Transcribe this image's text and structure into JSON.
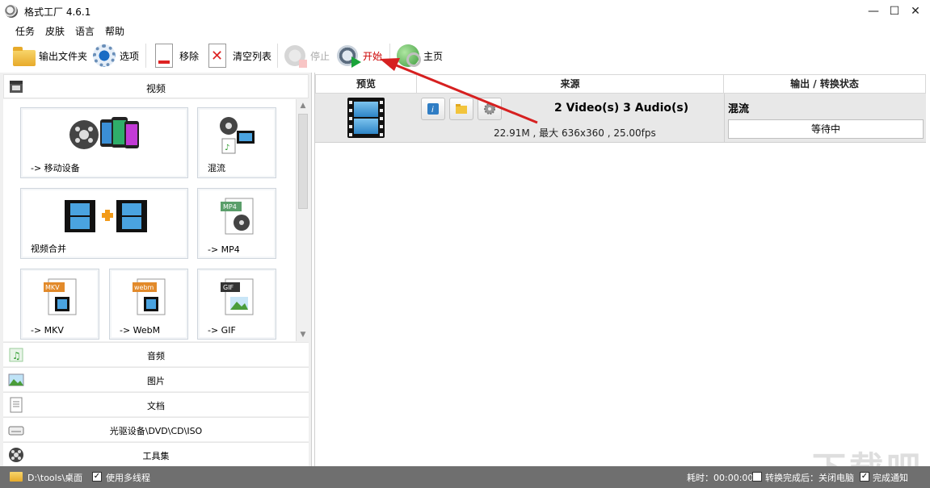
{
  "window": {
    "title": "格式工厂 4.6.1",
    "minimize": "—",
    "maximize": "☐",
    "close": "✕"
  },
  "menu": [
    "任务",
    "皮肤",
    "语言",
    "帮助"
  ],
  "toolbar": {
    "output_folder": "输出文件夹",
    "options": "选项",
    "remove": "移除",
    "clear_list": "清空列表",
    "stop": "停止",
    "start": "开始",
    "home": "主页"
  },
  "left": {
    "video_header": "视频",
    "tiles": [
      {
        "label": "-> 移动设备"
      },
      {
        "label": "混流"
      },
      {
        "label": "视频合并"
      },
      {
        "label": "-> MP4"
      },
      {
        "label": "-> MKV"
      },
      {
        "label": "-> WebM"
      },
      {
        "label": "-> GIF"
      }
    ],
    "tile_badges": {
      "mp4": "MP4",
      "mkv": "MKV",
      "webm": "webm",
      "gif": "GIF"
    },
    "categories": [
      "音频",
      "图片",
      "文档",
      "光驱设备\\DVD\\CD\\ISO",
      "工具集"
    ]
  },
  "right": {
    "columns": {
      "preview": "预览",
      "source": "来源",
      "output": "输出 / 转换状态"
    },
    "task": {
      "title": "2 Video(s) 3 Audio(s)",
      "detail": "22.91M , 最大 636x360 , 25.00fps",
      "type": "混流",
      "status": "等待中"
    }
  },
  "statusbar": {
    "path": "D:\\tools\\桌面",
    "multithread": "使用多线程",
    "elapsed": "耗时：00:00:00",
    "after_done": "转换完成后：关闭电脑",
    "notify": "完成通知",
    "multithread_checked": true,
    "after_done_checked": false,
    "notify_checked": true
  },
  "watermark": "下载吧",
  "colors": {
    "accent_red": "#d62020",
    "film_blue": "#2d84c6",
    "statusbar_bg": "#6f6f6f"
  }
}
